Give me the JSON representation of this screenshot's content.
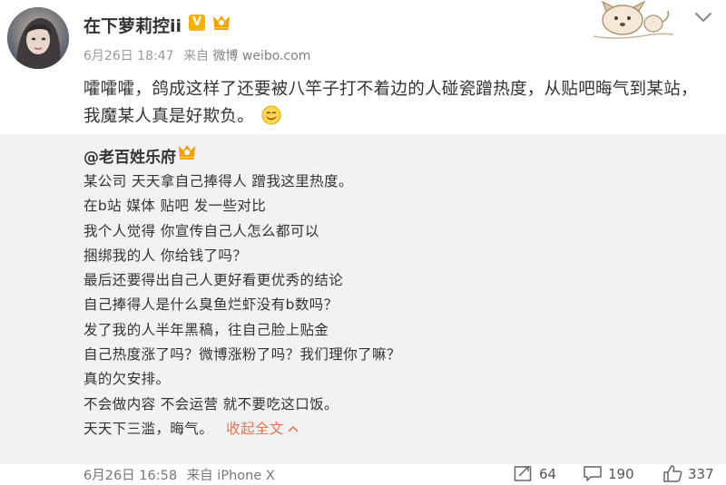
{
  "post": {
    "author": "在下萝莉控ii",
    "verified_mark": "V",
    "time": "6月26日 18:47",
    "source_prefix": "来自",
    "source": "微博 weibo.com",
    "text": "嚯嚯嚯，鸽成这样了还要被八竿子打不着边的人碰瓷蹭热度，从贴吧晦气到某站，我魔某人真是好欺负。",
    "emoji": "smile-emoji"
  },
  "repost": {
    "author": "@老百姓乐府",
    "lines": [
      "某公司 天天拿自己捧得人 蹭我这里热度。",
      "在b站 媒体 贴吧 发一些对比",
      "我个人觉得 你宣传自己人怎么都可以",
      "捆绑我的人 你给钱了吗？",
      "最后还要得出自己人更好看更优秀的结论",
      "自己捧得人是什么臭鱼烂虾没有b数吗？",
      "发了我的人半年黑稿，往自己脸上贴金",
      "自己热度涨了吗？微博涨粉了吗？我们理你了嘛？",
      "真的欠安排。",
      "不会做内容 不会运营 就不要吃这口饭。",
      "天天下三滥，晦气。"
    ],
    "collapse_label": "收起全文",
    "time": "6月26日 16:58",
    "source_prefix": "来自",
    "source": "iPhone X",
    "reposts": "64",
    "comments": "190",
    "likes": "337"
  },
  "icons": [
    "avatar",
    "verified-icon",
    "member-badge-icon",
    "dog-decoration-icon",
    "chevron-down-icon",
    "smile-emoji",
    "caret-up-icon",
    "repost-icon",
    "comment-icon",
    "like-icon"
  ],
  "colors": {
    "link": "#eb7350",
    "verified": "#f7b100",
    "repost_bg": "#f2f2f5",
    "meta": "#999999"
  }
}
